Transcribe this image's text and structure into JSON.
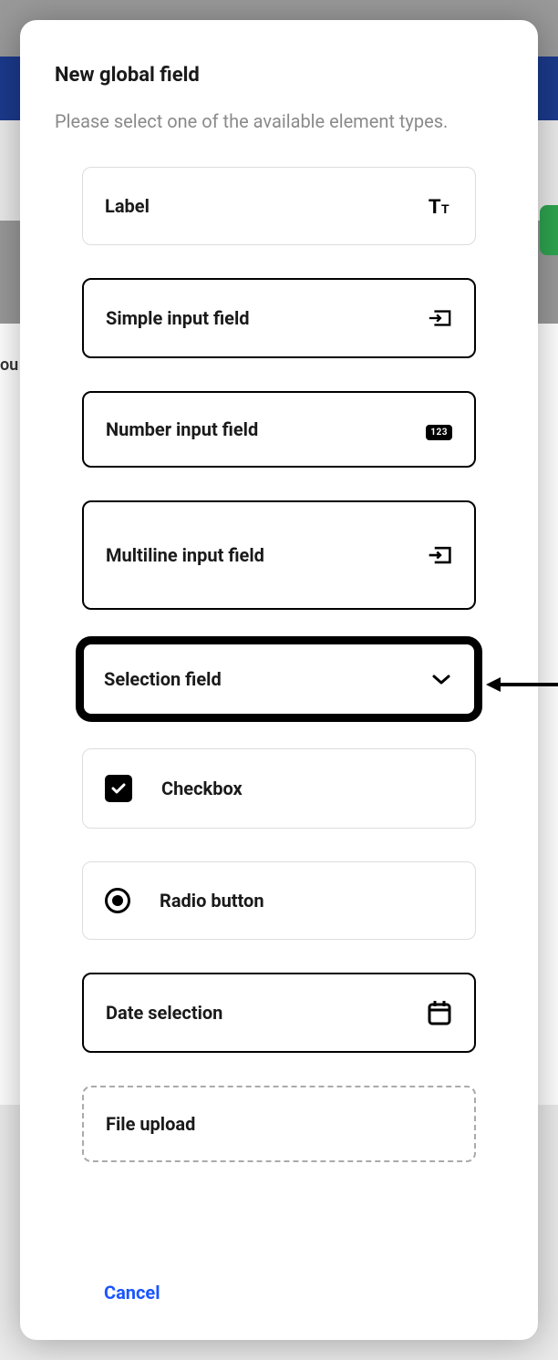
{
  "background": {
    "partial_text": "ou"
  },
  "modal": {
    "title": "New global field",
    "subtitle": "Please select one of the available element types.",
    "cancel_label": "Cancel"
  },
  "options": [
    {
      "label": "Label",
      "icon": "text-format-icon",
      "style": "light",
      "leading": false
    },
    {
      "label": "Simple input field",
      "icon": "input-icon",
      "style": "thick",
      "leading": false
    },
    {
      "label": "Number input field",
      "icon": "number-icon",
      "style": "thick",
      "leading": false
    },
    {
      "label": "Multiline input field",
      "icon": "input-icon",
      "style": "thick",
      "leading": false
    },
    {
      "label": "Selection field",
      "icon": "chevron-down-icon",
      "style": "highlighted",
      "leading": false
    },
    {
      "label": "Checkbox",
      "icon": "checkbox-icon",
      "style": "light",
      "leading": true
    },
    {
      "label": "Radio button",
      "icon": "radio-icon",
      "style": "light",
      "leading": true
    },
    {
      "label": "Date selection",
      "icon": "calendar-icon",
      "style": "thick",
      "leading": false
    },
    {
      "label": "File upload",
      "icon": null,
      "style": "dashed",
      "leading": false
    }
  ],
  "annotation": {
    "arrow_points_to": "Selection field"
  }
}
